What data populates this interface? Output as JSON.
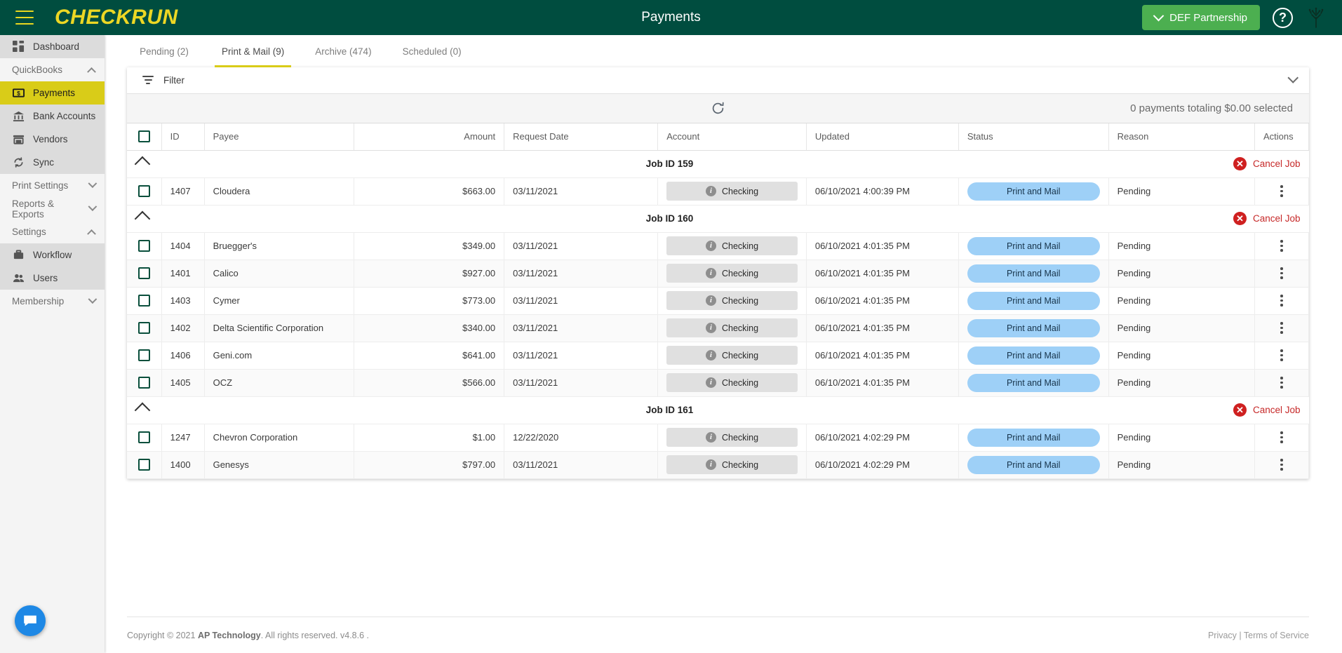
{
  "topbar": {
    "menu_icon": "hamburger-icon",
    "brand": "CHECKRUN",
    "title": "Payments",
    "org_button": "DEF Partnership",
    "help_icon": "question-mark-icon",
    "logo_icon": "tree-icon"
  },
  "sidebar": {
    "items": [
      {
        "label": "Dashboard",
        "icon": "dashboard-icon",
        "type": "item",
        "active": false
      },
      {
        "label": "QuickBooks",
        "icon": "chevron-up-icon",
        "type": "group",
        "expanded": true
      },
      {
        "label": "Payments",
        "icon": "money-icon",
        "type": "item",
        "active": true
      },
      {
        "label": "Bank Accounts",
        "icon": "bank-icon",
        "type": "item",
        "active": false
      },
      {
        "label": "Vendors",
        "icon": "store-icon",
        "type": "item",
        "active": false
      },
      {
        "label": "Sync",
        "icon": "sync-icon",
        "type": "item",
        "active": false
      },
      {
        "label": "Print Settings",
        "icon": "chevron-down-icon",
        "type": "group",
        "expanded": false
      },
      {
        "label": "Reports & Exports",
        "icon": "chevron-down-icon",
        "type": "group",
        "expanded": false
      },
      {
        "label": "Settings",
        "icon": "chevron-up-icon",
        "type": "group",
        "expanded": true
      },
      {
        "label": "Workflow",
        "icon": "briefcase-icon",
        "type": "item",
        "active": false
      },
      {
        "label": "Users",
        "icon": "users-icon",
        "type": "item",
        "active": false
      },
      {
        "label": "Membership",
        "icon": "chevron-down-icon",
        "type": "group",
        "expanded": false
      }
    ]
  },
  "tabs": [
    {
      "label": "Pending (2)",
      "active": false
    },
    {
      "label": "Print & Mail (9)",
      "active": true
    },
    {
      "label": "Archive (474)",
      "active": false
    },
    {
      "label": "Scheduled (0)",
      "active": false
    }
  ],
  "filter": {
    "label": "Filter",
    "icon": "filter-icon",
    "expand_icon": "chevron-down-icon"
  },
  "toolbar": {
    "refresh_icon": "refresh-icon",
    "selection_summary": "0 payments totaling $0.00 selected"
  },
  "table": {
    "columns": [
      "ID",
      "Payee",
      "Amount",
      "Request Date",
      "Account",
      "Updated",
      "Status",
      "Reason",
      "Actions"
    ],
    "cancel_job_label": "Cancel Job",
    "groups": [
      {
        "title": "Job ID 159",
        "rows": [
          {
            "id": "1407",
            "payee": "Cloudera",
            "amount": "$663.00",
            "request_date": "03/11/2021",
            "account": "Checking",
            "updated": "06/10/2021 4:00:39 PM",
            "status": "Print and Mail",
            "reason": "Pending"
          }
        ]
      },
      {
        "title": "Job ID 160",
        "rows": [
          {
            "id": "1404",
            "payee": "Bruegger's",
            "amount": "$349.00",
            "request_date": "03/11/2021",
            "account": "Checking",
            "updated": "06/10/2021 4:01:35 PM",
            "status": "Print and Mail",
            "reason": "Pending"
          },
          {
            "id": "1401",
            "payee": "Calico",
            "amount": "$927.00",
            "request_date": "03/11/2021",
            "account": "Checking",
            "updated": "06/10/2021 4:01:35 PM",
            "status": "Print and Mail",
            "reason": "Pending"
          },
          {
            "id": "1403",
            "payee": "Cymer",
            "amount": "$773.00",
            "request_date": "03/11/2021",
            "account": "Checking",
            "updated": "06/10/2021 4:01:35 PM",
            "status": "Print and Mail",
            "reason": "Pending"
          },
          {
            "id": "1402",
            "payee": "Delta Scientific Corporation",
            "amount": "$340.00",
            "request_date": "03/11/2021",
            "account": "Checking",
            "updated": "06/10/2021 4:01:35 PM",
            "status": "Print and Mail",
            "reason": "Pending"
          },
          {
            "id": "1406",
            "payee": "Geni.com",
            "amount": "$641.00",
            "request_date": "03/11/2021",
            "account": "Checking",
            "updated": "06/10/2021 4:01:35 PM",
            "status": "Print and Mail",
            "reason": "Pending"
          },
          {
            "id": "1405",
            "payee": "OCZ",
            "amount": "$566.00",
            "request_date": "03/11/2021",
            "account": "Checking",
            "updated": "06/10/2021 4:01:35 PM",
            "status": "Print and Mail",
            "reason": "Pending"
          }
        ]
      },
      {
        "title": "Job ID 161",
        "rows": [
          {
            "id": "1247",
            "payee": "Chevron Corporation",
            "amount": "$1.00",
            "request_date": "12/22/2020",
            "account": "Checking",
            "updated": "06/10/2021 4:02:29 PM",
            "status": "Print and Mail",
            "reason": "Pending"
          },
          {
            "id": "1400",
            "payee": "Genesys",
            "amount": "$797.00",
            "request_date": "03/11/2021",
            "account": "Checking",
            "updated": "06/10/2021 4:02:29 PM",
            "status": "Print and Mail",
            "reason": "Pending"
          }
        ]
      }
    ]
  },
  "footer": {
    "copyright_pre": "Copyright © 2021 ",
    "company": "AP Technology",
    "copyright_post": ". All rights reserved. v4.8.6 .",
    "privacy": "Privacy",
    "separator": " | ",
    "terms": "Terms of Service"
  },
  "chat": {
    "icon": "chat-bubble-icon"
  },
  "colors": {
    "brand_green": "#004d3f",
    "brand_yellow": "#d9cc18",
    "org_green": "#4caf50",
    "status_blue": "#9ed0f7",
    "danger_red": "#cf2020"
  }
}
